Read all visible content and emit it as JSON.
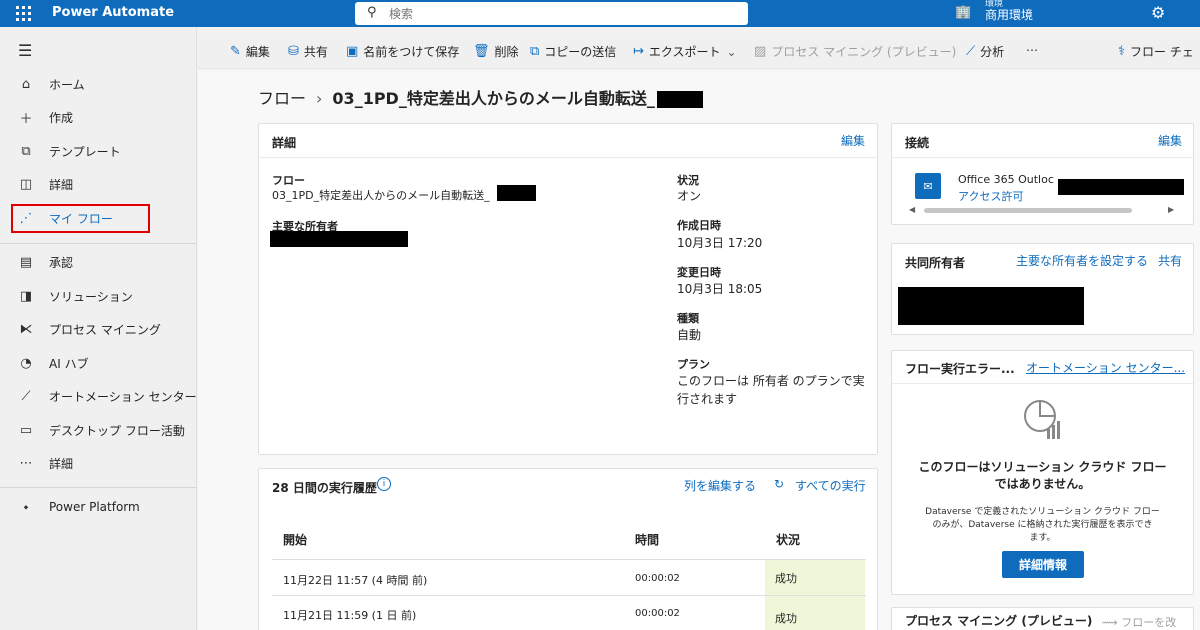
{
  "topbar": {
    "app_name": "Power Automate",
    "search_placeholder": "検索",
    "environment_label": "環境",
    "environment_name": "商用環境"
  },
  "nav": {
    "items": [
      {
        "label": "ホーム",
        "icon": "home-icon"
      },
      {
        "label": "作成",
        "icon": "plus-icon"
      },
      {
        "label": "テンプレート",
        "icon": "template-icon"
      },
      {
        "label": "詳細",
        "icon": "book-icon"
      },
      {
        "label": "マイ フロー",
        "icon": "flow-icon"
      },
      {
        "label": "承認",
        "icon": "approval-icon"
      },
      {
        "label": "ソリューション",
        "icon": "solution-icon"
      },
      {
        "label": "プロセス マイニング",
        "icon": "process-mining-icon"
      },
      {
        "label": "AI ハブ",
        "icon": "ai-hub-icon"
      },
      {
        "label": "オートメーション センター",
        "icon": "chart-icon"
      },
      {
        "label": "デスクトップ フロー活動",
        "icon": "desktop-icon"
      },
      {
        "label": "詳細",
        "icon": "more-icon"
      },
      {
        "label": "Power Platform",
        "icon": "power-platform-icon"
      }
    ]
  },
  "commands": {
    "edit": "編集",
    "share": "共有",
    "save_as": "名前をつけて保存",
    "delete": "削除",
    "send_copy": "コピーの送信",
    "export": "エクスポート",
    "process_mining": "プロセス マイニング (プレビュー)",
    "analytics": "分析",
    "more": "⋯",
    "flow_checker": "フロー チェ"
  },
  "breadcrumb": {
    "root": "フロー",
    "current": "03_1PD_特定差出人からのメール自動転送_"
  },
  "details": {
    "title": "詳細",
    "edit": "編集",
    "flow_label": "フロー",
    "flow_value": "03_1PD_特定差出人からのメール自動転送_",
    "owner_label": "主要な所有者",
    "status_label": "状況",
    "status_value": "オン",
    "created_label": "作成日時",
    "created_value": "10月3日 17:20",
    "modified_label": "変更日時",
    "modified_value": "10月3日 18:05",
    "type_label": "種類",
    "type_value": "自動",
    "plan_label": "プラン",
    "plan_value_1": "このフローは 所有者 のプランで実",
    "plan_value_2": "行されます"
  },
  "history": {
    "title": "28 日間の実行履歴",
    "edit_columns": "列を編集する",
    "all_runs": "すべての実行",
    "col_start": "開始",
    "col_duration": "時間",
    "col_status": "状況",
    "rows": [
      {
        "start": "11月22日 11:57 (4 時間 前)",
        "duration": "00:00:02",
        "status": "成功"
      },
      {
        "start": "11月21日 11:59 (1 日 前)",
        "duration": "00:00:02",
        "status": "成功"
      }
    ]
  },
  "connections": {
    "title": "接続",
    "edit": "編集",
    "connector_name": "Office 365 Outloc",
    "permission": "アクセス許可"
  },
  "coowners": {
    "title": "共同所有者",
    "set_owner": "主要な所有者を設定する",
    "share": "共有"
  },
  "errors": {
    "title": "フロー実行エラー...",
    "automation_center": "オートメーション センター...",
    "heading_1": "このフローはソリューション クラウド フロー",
    "heading_2": "ではありません。",
    "desc_1": "Dataverse で定義されたソリューション クラウド フロー",
    "desc_2": "のみが、Dataverse に格納された実行履歴を表示でき",
    "desc_3": "ます。",
    "button": "詳細情報"
  },
  "process_mining_card": {
    "title": "プロセス マイニング (プレビュー)",
    "link": "フローを改"
  },
  "colors": {
    "brand": "#0f6cbd",
    "highlight": "#e00000",
    "success_bg": "#f0f7d8"
  }
}
